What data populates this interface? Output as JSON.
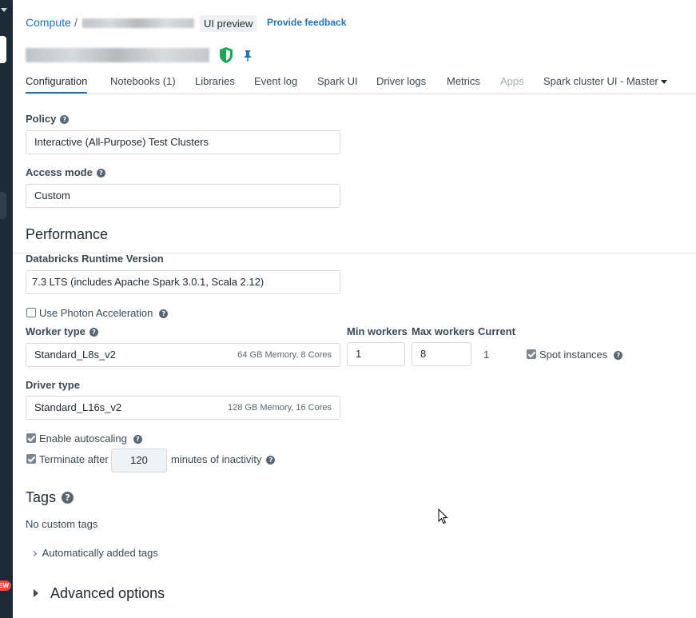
{
  "breadcrumb": {
    "root": "Compute",
    "separator": "/",
    "preview_badge": "UI preview",
    "feedback_link": "Provide feedback"
  },
  "tabs": [
    {
      "label": "Configuration",
      "state": "active"
    },
    {
      "label": "Notebooks (1)",
      "state": "normal"
    },
    {
      "label": "Libraries",
      "state": "normal"
    },
    {
      "label": "Event log",
      "state": "normal"
    },
    {
      "label": "Spark UI",
      "state": "normal"
    },
    {
      "label": "Driver logs",
      "state": "normal"
    },
    {
      "label": "Metrics",
      "state": "normal"
    },
    {
      "label": "Apps",
      "state": "disabled"
    },
    {
      "label": "Spark cluster UI - Master",
      "state": "dropdown"
    }
  ],
  "policy": {
    "label": "Policy",
    "value": "Interactive (All-Purpose) Test Clusters"
  },
  "access_mode": {
    "label": "Access mode",
    "value": "Custom"
  },
  "performance": {
    "title": "Performance",
    "runtime_label": "Databricks Runtime Version",
    "runtime_value": "7.3 LTS (includes Apache Spark 3.0.1, Scala 2.12)",
    "photon_label": "Use Photon Acceleration",
    "photon_checked": false
  },
  "worker": {
    "label": "Worker type",
    "value": "Standard_L8s_v2",
    "meta": "64 GB Memory, 8 Cores",
    "min_label": "Min workers",
    "min_value": "1",
    "max_label": "Max workers",
    "max_value": "8",
    "current_label": "Current",
    "current_value": "1",
    "spot_label": "Spot instances",
    "spot_checked": true
  },
  "driver": {
    "label": "Driver type",
    "value": "Standard_L16s_v2",
    "meta": "128 GB Memory, 16 Cores"
  },
  "autoscaling": {
    "label": "Enable autoscaling",
    "checked": true
  },
  "terminate": {
    "label_before": "Terminate after",
    "minutes": "120",
    "label_after": "minutes of inactivity",
    "checked": true
  },
  "tags": {
    "title": "Tags",
    "empty_text": "No custom tags",
    "auto_tags_label": "Automatically added tags"
  },
  "advanced": {
    "label": "Advanced options"
  },
  "sidebar": {
    "new_badge": "EW"
  },
  "colors": {
    "accent": "#2272b4",
    "shield": "#1ea35f",
    "pin": "#2272b4"
  }
}
